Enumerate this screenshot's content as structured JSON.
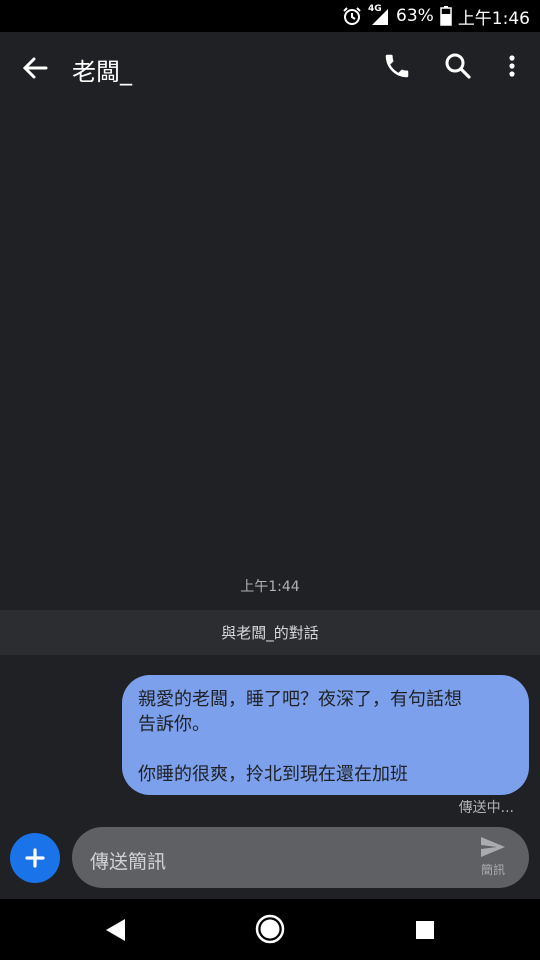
{
  "status_bar": {
    "network": "4G",
    "battery": "63%",
    "time": "上午1:46"
  },
  "header": {
    "title": "老闆_",
    "icons": [
      "back-arrow-icon",
      "phone-icon",
      "search-icon",
      "more-vert-icon"
    ]
  },
  "conversation": {
    "timestamp": "上午1:44",
    "banner": "與老闆_的對話",
    "message": {
      "line1": "親愛的老闆，睡了吧？夜深了，有句話想",
      "line2": "告訴你。",
      "line3": "你睡的很爽，拎北到現在還在加班"
    },
    "status": "傳送中..."
  },
  "composer": {
    "placeholder": "傳送簡訊",
    "send_label": "簡訊"
  },
  "colors": {
    "background": "#202124",
    "bubble": "#7ca0ec",
    "accent": "#1a73e8"
  }
}
